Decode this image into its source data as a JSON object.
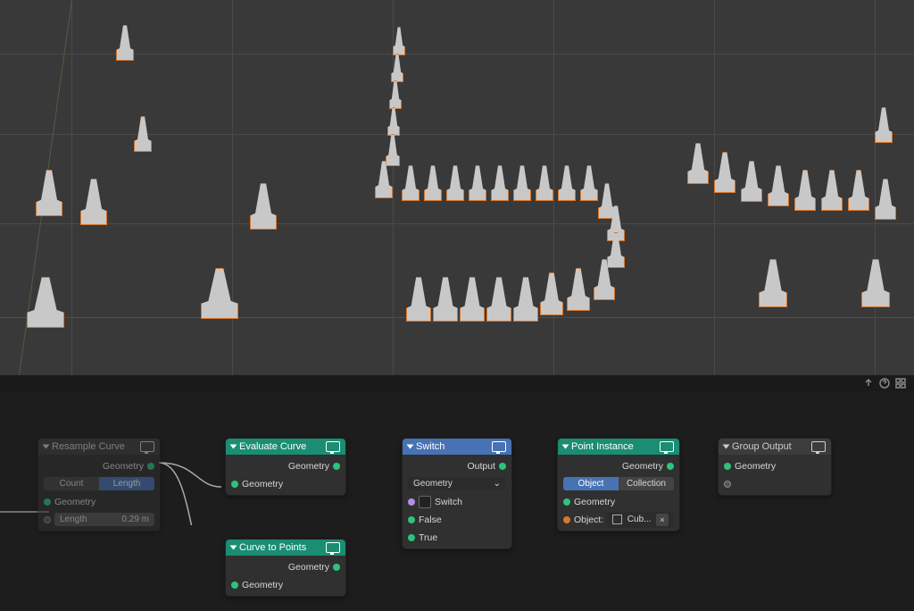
{
  "viewport": {},
  "divider_icons": [
    "arrow-up",
    "circle-help",
    "grid-snap"
  ],
  "nodes": {
    "resample": {
      "title": "Resample Curve",
      "out_geometry": "Geometry",
      "mode": {
        "count": "Count",
        "length": "Length",
        "active": "Length"
      },
      "in_geometry": "Geometry",
      "length_label": "Length",
      "length_value": "0.29 m"
    },
    "evaluate": {
      "title": "Evaluate Curve",
      "out_geometry": "Geometry",
      "in_geometry": "Geometry"
    },
    "curve_to_points": {
      "title": "Curve to Points",
      "out_geometry": "Geometry",
      "in_geometry": "Geometry"
    },
    "switch": {
      "title": "Switch",
      "out_output": "Output",
      "type_value": "Geometry",
      "in_switch": "Switch",
      "in_false": "False",
      "in_true": "True"
    },
    "point_instance": {
      "title": "Point Instance",
      "out_geometry": "Geometry",
      "mode": {
        "object": "Object",
        "collection": "Collection",
        "active": "Object"
      },
      "in_geometry": "Geometry",
      "object_label": "Object:",
      "object_value": "Cub..."
    },
    "group_output": {
      "title": "Group Output",
      "in_geometry": "Geometry"
    }
  }
}
